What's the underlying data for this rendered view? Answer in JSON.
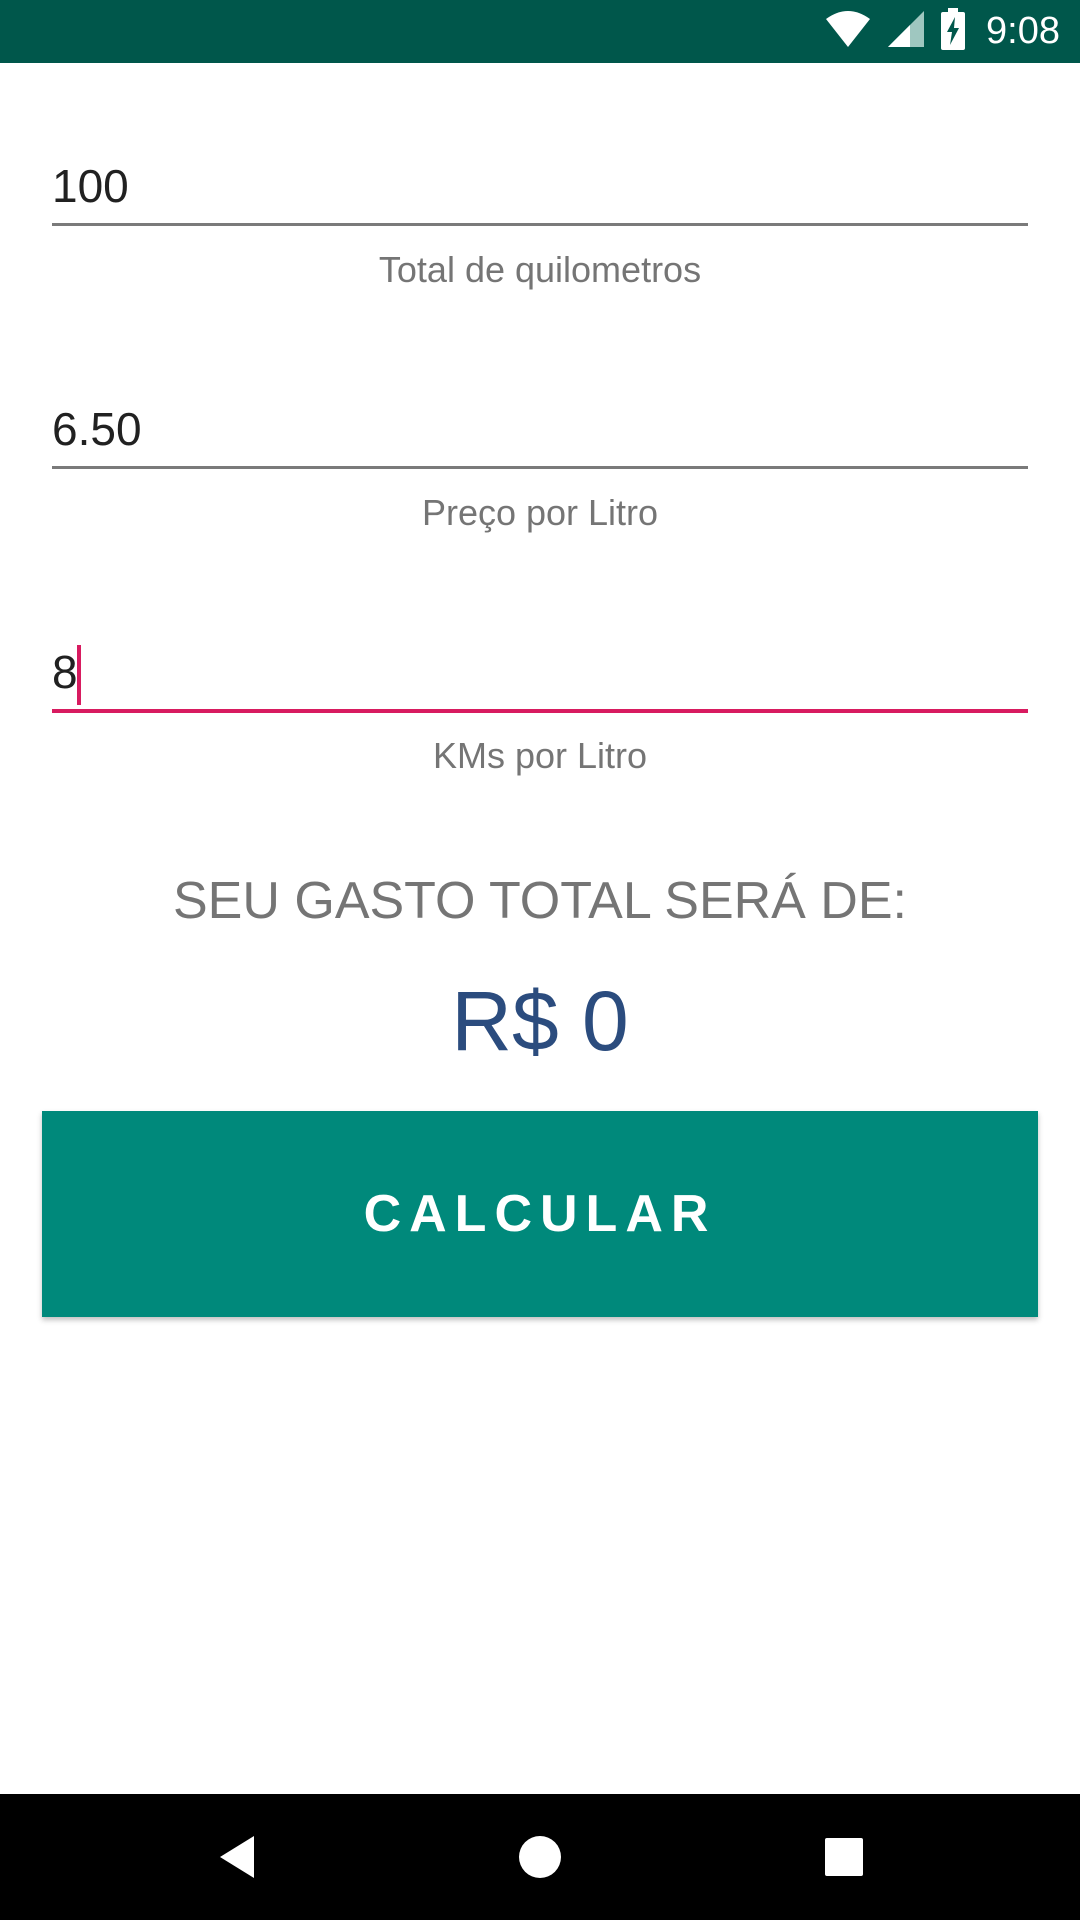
{
  "status_bar": {
    "time": "9:08",
    "icons": [
      "wifi-icon",
      "cell-signal-icon",
      "battery-charging-icon"
    ],
    "color": "#00574b"
  },
  "fields": [
    {
      "value": "100",
      "label": "Total de quilometros",
      "focused": false
    },
    {
      "value": "6.50",
      "label": "Preço por Litro",
      "focused": false
    },
    {
      "value": "8",
      "label": "KMs por Litro",
      "focused": true
    }
  ],
  "result": {
    "label": "SEU GASTO TOTAL SERÁ DE:",
    "value": "R$ 0",
    "value_color": "#2b4c7e"
  },
  "button": {
    "label": "CALCULAR",
    "color": "#00897b"
  },
  "nav_bar": {
    "icons": [
      "back-icon",
      "home-icon",
      "recents-icon"
    ]
  },
  "accent_color": "#d81b60"
}
